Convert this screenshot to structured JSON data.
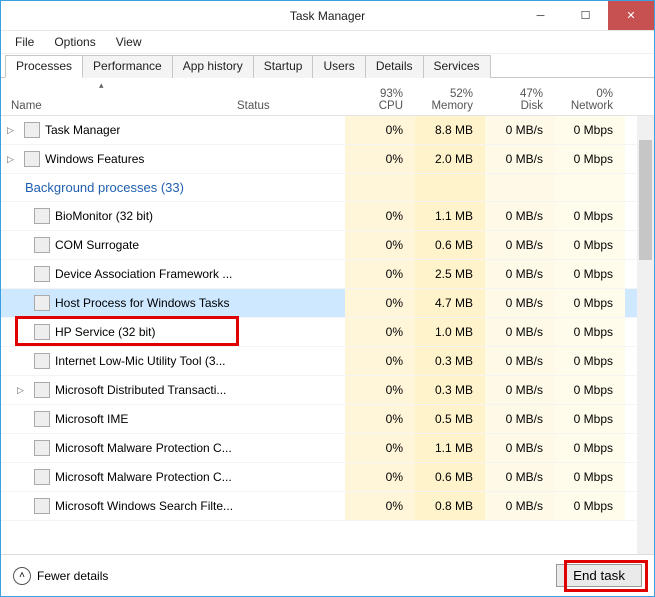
{
  "window": {
    "title": "Task Manager"
  },
  "menu": {
    "file": "File",
    "options": "Options",
    "view": "View"
  },
  "tabs": {
    "processes": "Processes",
    "performance": "Performance",
    "apphistory": "App history",
    "startup": "Startup",
    "users": "Users",
    "details": "Details",
    "services": "Services"
  },
  "header": {
    "name": "Name",
    "status": "Status",
    "cpu_pct": "93%",
    "cpu": "CPU",
    "mem_pct": "52%",
    "mem": "Memory",
    "disk_pct": "47%",
    "disk": "Disk",
    "net_pct": "0%",
    "net": "Network"
  },
  "group_label": "Background processes (33)",
  "rows": [
    {
      "exp": true,
      "name": "Task Manager",
      "cpu": "0%",
      "mem": "8.8 MB",
      "disk": "0 MB/s",
      "net": "0 Mbps"
    },
    {
      "exp": true,
      "name": "Windows Features",
      "cpu": "0%",
      "mem": "2.0 MB",
      "disk": "0 MB/s",
      "net": "0 Mbps"
    },
    {
      "exp": false,
      "name": "BioMonitor (32 bit)",
      "cpu": "0%",
      "mem": "1.1 MB",
      "disk": "0 MB/s",
      "net": "0 Mbps"
    },
    {
      "exp": false,
      "name": "COM Surrogate",
      "cpu": "0%",
      "mem": "0.6 MB",
      "disk": "0 MB/s",
      "net": "0 Mbps"
    },
    {
      "exp": false,
      "name": "Device Association Framework ...",
      "cpu": "0%",
      "mem": "2.5 MB",
      "disk": "0 MB/s",
      "net": "0 Mbps"
    },
    {
      "exp": false,
      "name": "Host Process for Windows Tasks",
      "sel": true,
      "cpu": "0%",
      "mem": "4.7 MB",
      "disk": "0 MB/s",
      "net": "0 Mbps"
    },
    {
      "exp": false,
      "name": "HP Service (32 bit)",
      "hl": true,
      "cpu": "0%",
      "mem": "1.0 MB",
      "disk": "0 MB/s",
      "net": "0 Mbps"
    },
    {
      "exp": false,
      "name": "Internet Low-Mic Utility Tool (3...",
      "cpu": "0%",
      "mem": "0.3 MB",
      "disk": "0 MB/s",
      "net": "0 Mbps"
    },
    {
      "exp": true,
      "name": "Microsoft Distributed Transacti...",
      "cpu": "0%",
      "mem": "0.3 MB",
      "disk": "0 MB/s",
      "net": "0 Mbps"
    },
    {
      "exp": false,
      "name": "Microsoft IME",
      "cpu": "0%",
      "mem": "0.5 MB",
      "disk": "0 MB/s",
      "net": "0 Mbps"
    },
    {
      "exp": false,
      "name": "Microsoft Malware Protection C...",
      "cpu": "0%",
      "mem": "1.1 MB",
      "disk": "0 MB/s",
      "net": "0 Mbps"
    },
    {
      "exp": false,
      "name": "Microsoft Malware Protection C...",
      "cpu": "0%",
      "mem": "0.6 MB",
      "disk": "0 MB/s",
      "net": "0 Mbps"
    },
    {
      "exp": false,
      "name": "Microsoft Windows Search Filte...",
      "cpu": "0%",
      "mem": "0.8 MB",
      "disk": "0 MB/s",
      "net": "0 Mbps"
    }
  ],
  "footer": {
    "fewer": "Fewer details",
    "endtask": "End task"
  }
}
